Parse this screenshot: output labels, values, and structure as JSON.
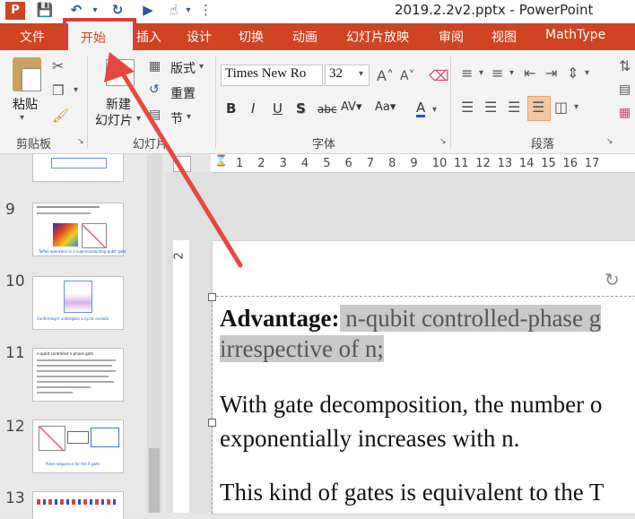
{
  "window": {
    "title": "2019.2.2v2.pptx - PowerPoint",
    "quick_access": [
      "powerpoint-logo-icon",
      "save-icon",
      "undo-icon",
      "redo-icon",
      "present-icon",
      "touch-mode-icon",
      "customize-icon"
    ]
  },
  "tabs": [
    {
      "label": "文件"
    },
    {
      "label": "开始"
    },
    {
      "label": "插入"
    },
    {
      "label": "设计"
    },
    {
      "label": "切换"
    },
    {
      "label": "动画"
    },
    {
      "label": "幻灯片放映"
    },
    {
      "label": "审阅"
    },
    {
      "label": "视图"
    },
    {
      "label": "MathType"
    }
  ],
  "ribbon": {
    "clipboard": {
      "paste_label": "粘贴",
      "group_label": "剪贴板"
    },
    "slides": {
      "new_slide_line1": "新建",
      "new_slide_line2": "幻灯片",
      "layout_label": "版式",
      "reset_label": "重置",
      "section_label": "节",
      "group_label": "幻灯片"
    },
    "font": {
      "font_name": "Times New Ro",
      "font_size": "32",
      "group_label": "字体"
    },
    "paragraph": {
      "group_label": "段落"
    }
  },
  "thumbnails": [
    {
      "number": "9",
      "caption": "Toffoli operation in a superconducting qubit gate"
    },
    {
      "number": "10",
      "caption": "Confirming Il undergoes a cyclic evolution"
    },
    {
      "number": "11",
      "caption": "n-qubit controlled n-phase gate"
    },
    {
      "number": "12",
      "caption": "Pulse sequence for the X gate"
    },
    {
      "number": "13",
      "caption": ""
    }
  ],
  "ruler": {
    "ticks": [
      "1",
      "2",
      "3",
      "4",
      "5",
      "6",
      "7",
      "8",
      "9",
      "10",
      "11",
      "12",
      "13",
      "14",
      "15",
      "16",
      "17"
    ],
    "vertical_tick": "2"
  },
  "slide": {
    "line1_bold": "Advantage:",
    "line1_rest": " n-qubit controlled-phase g",
    "line2": "irrespective of n;",
    "line3": "With gate decomposition, the number o",
    "line4": "exponentially increases with n.",
    "line5": "This kind of gates is equivalent to the T"
  },
  "colors": {
    "accent": "#d04423",
    "highlight_box": "#e03a3a",
    "arrow": "#e8473f"
  }
}
